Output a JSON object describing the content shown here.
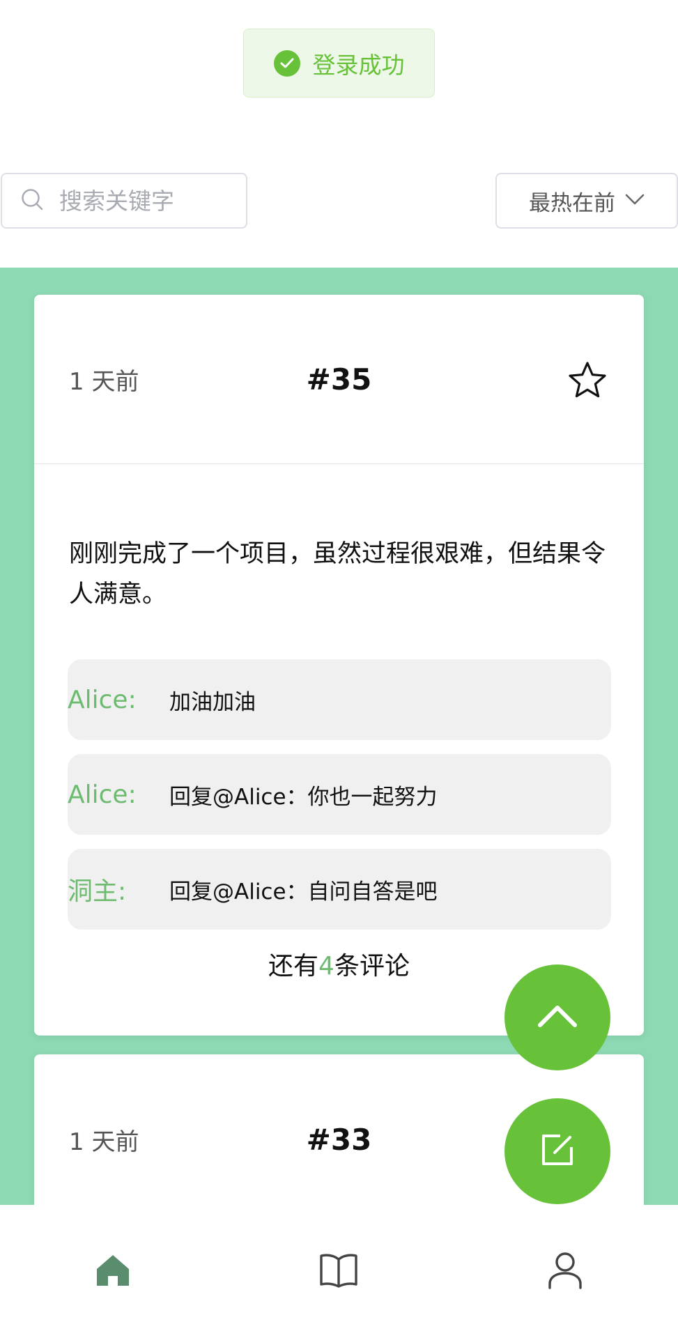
{
  "toast": {
    "text": "登录成功",
    "icon": "check-circle-icon",
    "color": "#67c23a"
  },
  "search": {
    "placeholder": "搜索关键字",
    "value": ""
  },
  "sort": {
    "selected": "最热在前"
  },
  "posts": [
    {
      "time": "1 天前",
      "number": "#35",
      "content": "刚刚完成了一个项目，虽然过程很艰难，但结果令人满意。",
      "comments": [
        {
          "author": "Alice:",
          "text": "加油加油"
        },
        {
          "author": "Alice:",
          "text": "回复@Alice：你也一起努力"
        },
        {
          "author": "洞主:",
          "text": "回复@Alice：自问自答是吧"
        }
      ],
      "more": {
        "prefix": "还有",
        "count": "4",
        "suffix": "条评论"
      }
    },
    {
      "time": "1 天前",
      "number": "#33"
    }
  ],
  "fabs": {
    "top_icon": "chevron-up-icon",
    "edit_icon": "edit-icon"
  },
  "tabbar": {
    "icons": [
      "home-icon",
      "book-icon",
      "user-icon"
    ],
    "active_color": "#5a8c6e"
  },
  "colors": {
    "accent": "#67c23a",
    "feed_bg": "#8dd9b3",
    "author": "#6dbb6f"
  }
}
